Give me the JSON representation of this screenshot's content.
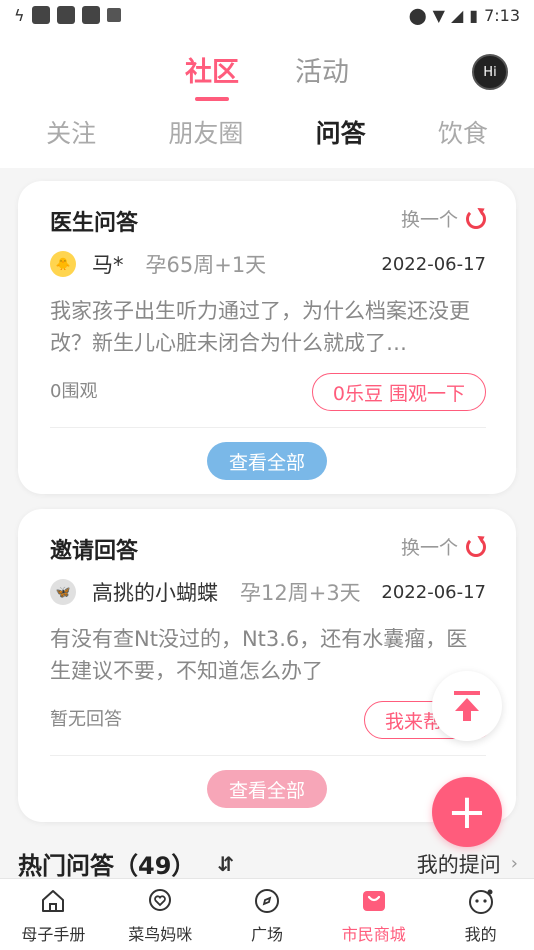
{
  "status_bar": {
    "time": "7:13"
  },
  "top_tabs": [
    {
      "label": "社区",
      "active": true
    },
    {
      "label": "活动",
      "active": false
    }
  ],
  "hi_button": "Hi",
  "sub_tabs": [
    {
      "label": "关注",
      "active": false
    },
    {
      "label": "朋友圈",
      "active": false
    },
    {
      "label": "问答",
      "active": true
    },
    {
      "label": "饮食",
      "active": false
    }
  ],
  "cards": [
    {
      "title": "医生问答",
      "swap_label": "换一个",
      "user": "马*",
      "weeks": "孕65周+1天",
      "date": "2022-06-17",
      "question": "我家孩子出生听力通过了，为什么档案还没更改？新生儿心脏未闭合为什么就成了…",
      "watchers": "0围观",
      "pill": "0乐豆 围观一下",
      "view_all": "查看全部"
    },
    {
      "title": "邀请回答",
      "swap_label": "换一个",
      "user": "高挑的小蝴蝶",
      "weeks": "孕12周+3天",
      "date": "2022-06-17",
      "question": "有没有查Nt没过的，Nt3.6，还有水囊瘤，医生建议不要，不知道怎么办了",
      "watchers": "暂无回答",
      "pill": "我来帮",
      "view_all": "查看全部"
    }
  ],
  "hot_section": {
    "title": "热门问答（49）",
    "sort_icon": "⇵",
    "my_questions": "我的提问"
  },
  "bottom_nav": [
    {
      "label": "母子手册",
      "icon": "home-icon",
      "active": false
    },
    {
      "label": "菜鸟妈咪",
      "icon": "chat-heart-icon",
      "active": false
    },
    {
      "label": "广场",
      "icon": "compass-icon",
      "active": false
    },
    {
      "label": "市民商城",
      "icon": "shopping-bag-icon",
      "active": true
    },
    {
      "label": "我的",
      "icon": "face-icon",
      "active": false
    }
  ],
  "colors": {
    "accent": "#ff5c7c",
    "blue_button": "#7ab8e8",
    "pink_button": "#f7a6b8"
  }
}
